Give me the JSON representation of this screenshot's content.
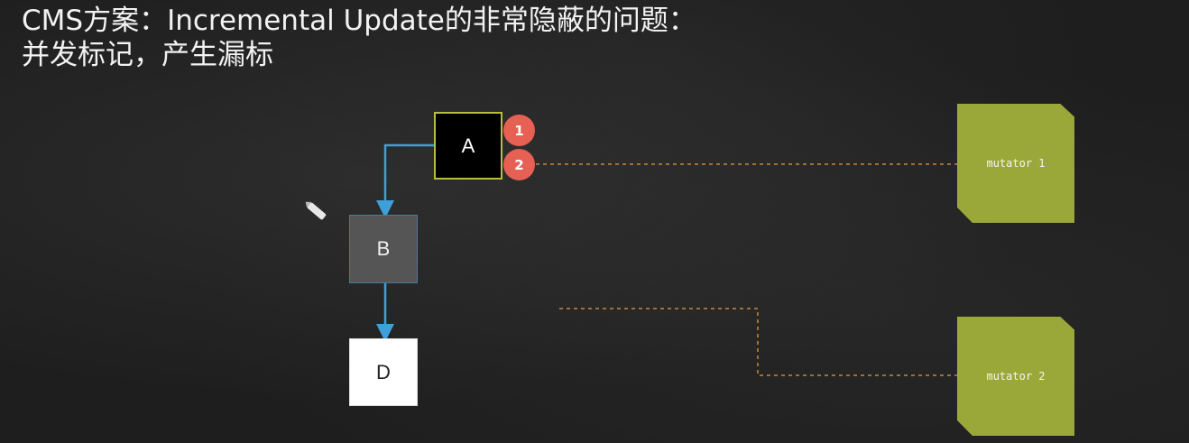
{
  "title": {
    "line1": "CMS方案：Incremental Update的非常隐蔽的问题：",
    "line2": "并发标记，产生漏标"
  },
  "nodes": {
    "a": "A",
    "b": "B",
    "d": "D"
  },
  "steps": {
    "one": "1",
    "two": "2"
  },
  "mutators": {
    "m1": "mutator 1",
    "m2": "mutator 2"
  },
  "colors": {
    "node_a_bg": "#000000",
    "node_a_border": "#b8bf3a",
    "node_b_bg": "#555555",
    "node_d_bg": "#ffffff",
    "step_badge": "#e66054",
    "mutator": "#9aa83a",
    "reference_arrow": "#3ea0d8",
    "dashed_link": "#c8873a"
  },
  "icons": {
    "cursor": "pencil-icon"
  }
}
